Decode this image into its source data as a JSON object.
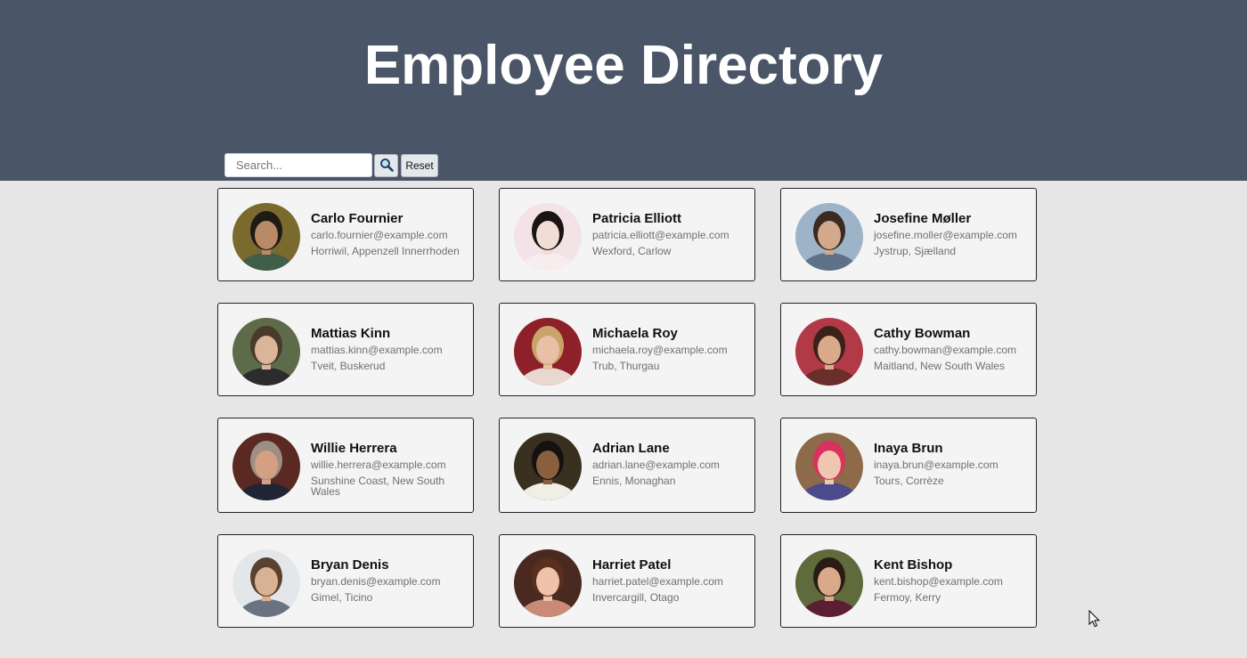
{
  "header": {
    "title": "Employee Directory",
    "bg_color": "#4a5568"
  },
  "search": {
    "placeholder": "Search...",
    "value": "",
    "search_icon": "magnifier-icon",
    "reset_label": "Reset"
  },
  "employees": [
    {
      "name": "Carlo Fournier",
      "email": "carlo.fournier@example.com",
      "location": "Horriwil, Appenzell Innerrhoden",
      "avatar_bg": "#7a6a2e",
      "skin": "#b98a66",
      "hair": "#1e1a16",
      "shirt": "#3f5f48"
    },
    {
      "name": "Patricia Elliott",
      "email": "patricia.elliott@example.com",
      "location": "Wexford, Carlow",
      "avatar_bg": "#f3e3e6",
      "skin": "#f1dcd6",
      "hair": "#1a1414",
      "shirt": "#f7ecee"
    },
    {
      "name": "Josefine Møller",
      "email": "josefine.moller@example.com",
      "location": "Jystrup, Sjælland",
      "avatar_bg": "#9db4c8",
      "skin": "#d2a98c",
      "hair": "#3b2a20",
      "shirt": "#5f7186"
    },
    {
      "name": "Mattias Kinn",
      "email": "mattias.kinn@example.com",
      "location": "Tveit, Buskerud",
      "avatar_bg": "#5d6b4b",
      "skin": "#dab59a",
      "hair": "#4b3a2a",
      "shirt": "#2c2c2c"
    },
    {
      "name": "Michaela Roy",
      "email": "michaela.roy@example.com",
      "location": "Trub, Thurgau",
      "avatar_bg": "#8e2029",
      "skin": "#e7c0a6",
      "hair": "#c9a46a",
      "shirt": "#e8d8cf"
    },
    {
      "name": "Cathy Bowman",
      "email": "cathy.bowman@example.com",
      "location": "Maitland, New South Wales",
      "avatar_bg": "#b23a47",
      "skin": "#d9a98a",
      "hair": "#3a221a",
      "shirt": "#6b2e2a"
    },
    {
      "name": "Willie Herrera",
      "email": "willie.herrera@example.com",
      "location": "Sunshine Coast, New South Wales",
      "avatar_bg": "#5a2a22",
      "skin": "#d4a083",
      "hair": "#9d8f83",
      "shirt": "#1f2535"
    },
    {
      "name": "Adrian Lane",
      "email": "adrian.lane@example.com",
      "location": "Ennis, Monaghan",
      "avatar_bg": "#3a3020",
      "skin": "#8a5f3e",
      "hair": "#151110",
      "shirt": "#f1eee6"
    },
    {
      "name": "Inaya Brun",
      "email": "inaya.brun@example.com",
      "location": "Tours, Corrèze",
      "avatar_bg": "#8c6a4a",
      "skin": "#efc7b1",
      "hair": "#d8325e",
      "shirt": "#4b4a8a"
    },
    {
      "name": "Bryan Denis",
      "email": "bryan.denis@example.com",
      "location": "Gimel, Ticino",
      "avatar_bg": "#e4e7ea",
      "skin": "#d9b193",
      "hair": "#5a4230",
      "shirt": "#6a7480"
    },
    {
      "name": "Harriet Patel",
      "email": "harriet.patel@example.com",
      "location": "Invercargill, Otago",
      "avatar_bg": "#4a2a20",
      "skin": "#efc2aa",
      "hair": "#5a2f1f",
      "shirt": "#c98a78"
    },
    {
      "name": "Kent Bishop",
      "email": "kent.bishop@example.com",
      "location": "Fermoy, Kerry",
      "avatar_bg": "#5f6b3c",
      "skin": "#d9a98a",
      "hair": "#2a1c14",
      "shirt": "#5a1f35"
    }
  ]
}
